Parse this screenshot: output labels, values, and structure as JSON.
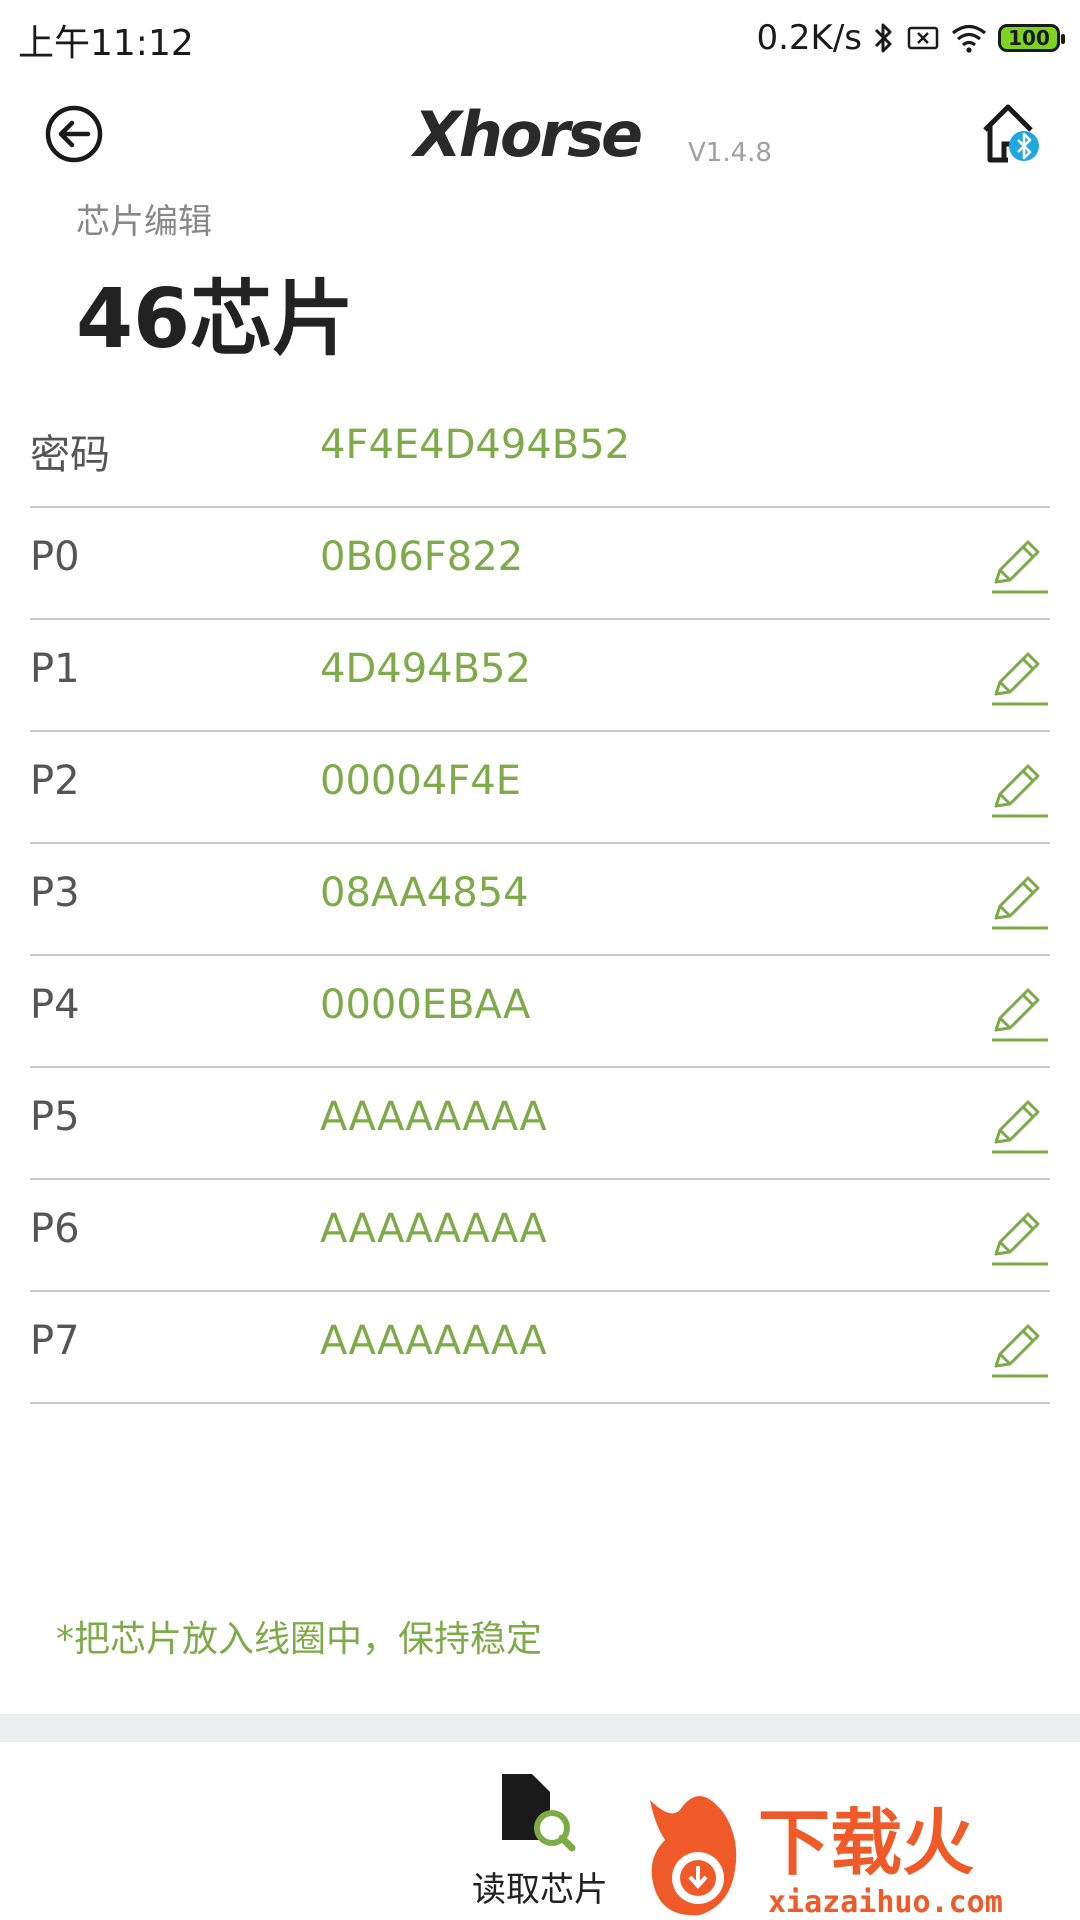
{
  "status_bar": {
    "time": "上午11:12",
    "speed": "0.2K/s",
    "battery": "100",
    "icons": [
      "bluetooth-icon",
      "sim-off-icon",
      "wifi-icon",
      "battery-icon"
    ]
  },
  "header": {
    "logo_text": "Xhorse",
    "version": "V1.4.8",
    "back_icon": "back-arrow-icon",
    "home_icon": "home-bluetooth-icon"
  },
  "breadcrumb": "芯片编辑",
  "title": "46芯片",
  "rows": [
    {
      "label": "密码",
      "value": "4F4E4D494B52",
      "editable": false
    },
    {
      "label": "P0",
      "value": "0B06F822",
      "editable": true
    },
    {
      "label": "P1",
      "value": "4D494B52",
      "editable": true
    },
    {
      "label": "P2",
      "value": "00004F4E",
      "editable": true
    },
    {
      "label": "P3",
      "value": "08AA4854",
      "editable": true
    },
    {
      "label": "P4",
      "value": "0000EBAA",
      "editable": true
    },
    {
      "label": "P5",
      "value": "AAAAAAAA",
      "editable": true
    },
    {
      "label": "P6",
      "value": "AAAAAAAA",
      "editable": true
    },
    {
      "label": "P7",
      "value": "AAAAAAAA",
      "editable": true
    }
  ],
  "hint": "*把芯片放入线圈中，保持稳定",
  "bottom": {
    "read_chip_label": "读取芯片",
    "read_chip_icon": "chip-search-icon"
  },
  "watermark": {
    "text": "下载火",
    "url": "xiazaihuo.com"
  },
  "colors": {
    "accent": "#7cab48",
    "text_dark": "#222222",
    "label": "#555555",
    "divider": "#c8c8c8",
    "watermark": "#f05a28"
  }
}
